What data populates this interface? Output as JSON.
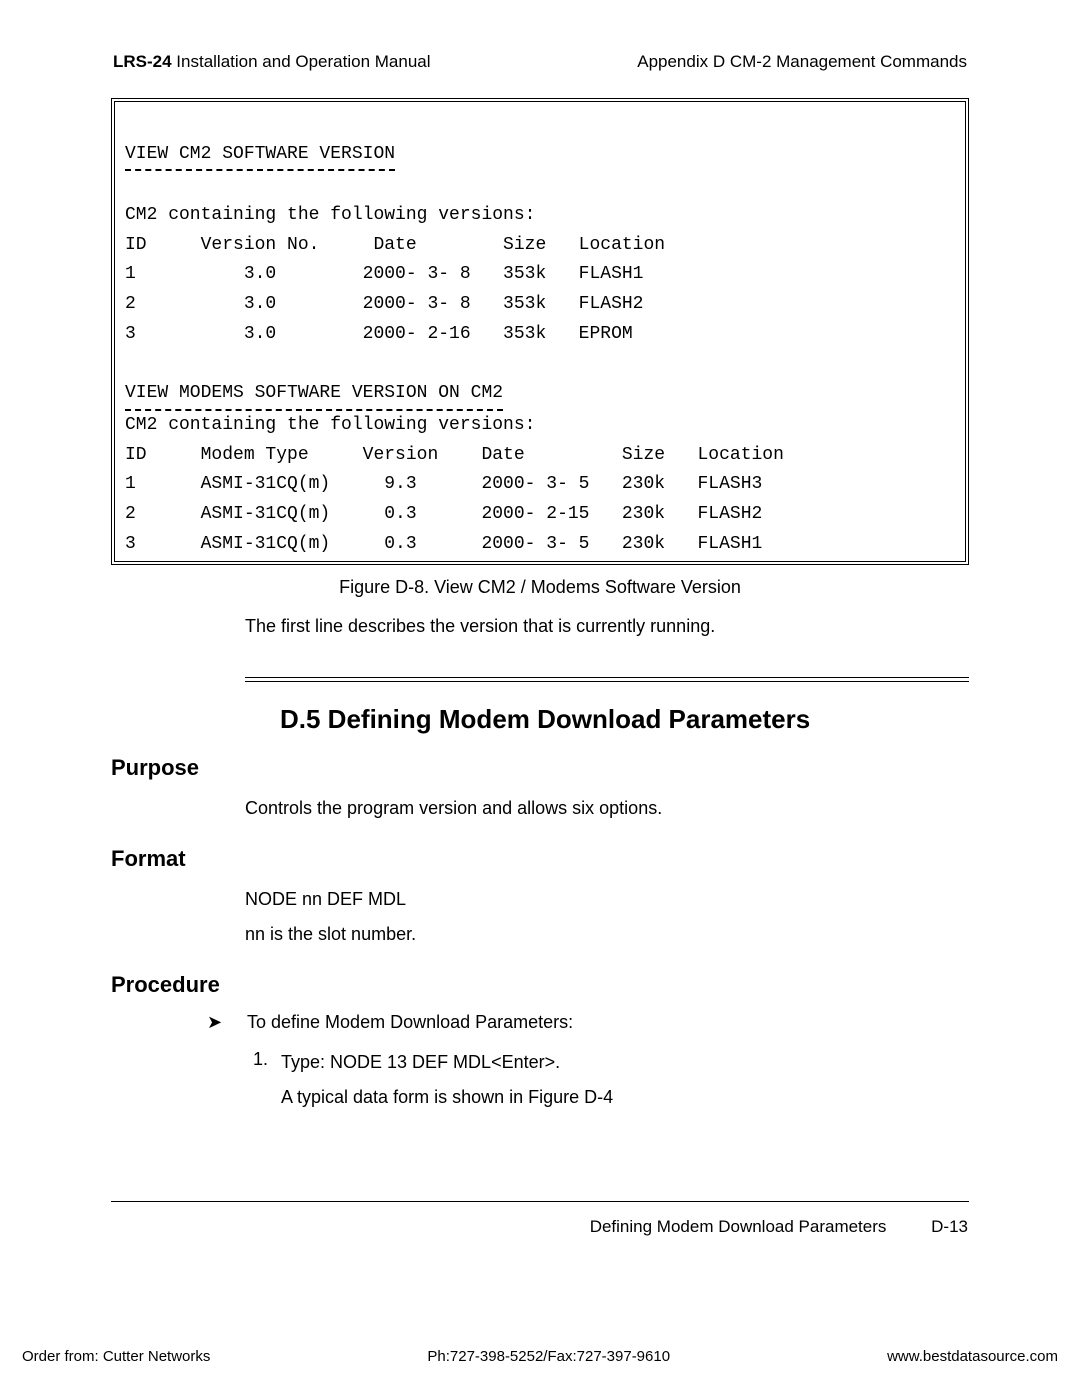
{
  "header": {
    "manualCode": "LRS-24",
    "manualTitle": " Installation and Operation Manual",
    "appendix": "Appendix D  CM-2 Management Commands"
  },
  "terminal": {
    "section1Title": "VIEW CM2 SOFTWARE VERSION",
    "intro1": "CM2 containing the following versions:",
    "cm2Head": "ID     Version No.     Date        Size   Location",
    "cm2Rows": [
      "1          3.0        2000- 3- 8   353k   FLASH1",
      "2          3.0        2000- 3- 8   353k   FLASH2",
      "3          3.0        2000- 2-16   353k   EPROM"
    ],
    "section2Title": "VIEW MODEMS SOFTWARE VERSION ON CM2",
    "intro2": "CM2 containing the following versions:",
    "modemHead": "ID     Modem Type     Version    Date         Size   Location",
    "modemRows": [
      "1      ASMI-31CQ(m)     9.3      2000- 3- 5   230k   FLASH3",
      "2      ASMI-31CQ(m)     0.3      2000- 2-15   230k   FLASH2",
      "3      ASMI-31CQ(m)     0.3      2000- 3- 5   230k   FLASH1"
    ]
  },
  "figure": {
    "caption": "Figure D-8.  View CM2 / Modems Software Version"
  },
  "bodyLine": "The first line describes the version that is currently running.",
  "section": {
    "title": "D.5 Defining Modem Download Parameters",
    "purposeLabel": "Purpose",
    "purposeText": "Controls the program version and allows six options.",
    "formatLabel": "Format",
    "formatLine1": "NODE nn DEF MDL",
    "formatLine2": "nn is the slot number.",
    "procedureLabel": "Procedure",
    "procIntro": "To define Modem Download Parameters:",
    "step1Label": "1.",
    "step1TypeWord": "Type: ",
    "step1Cmd": "NODE 13 DEF MDL<Enter>.",
    "step1Note": "A typical data form is shown in Figure D-4"
  },
  "footer": {
    "sectionName": "Defining Modem Download Parameters",
    "pageNum": "D-13",
    "orderFrom": "Order from: Cutter Networks",
    "phone": "Ph:727-398-5252/Fax:727-397-9610",
    "url": "www.bestdatasource.com"
  }
}
